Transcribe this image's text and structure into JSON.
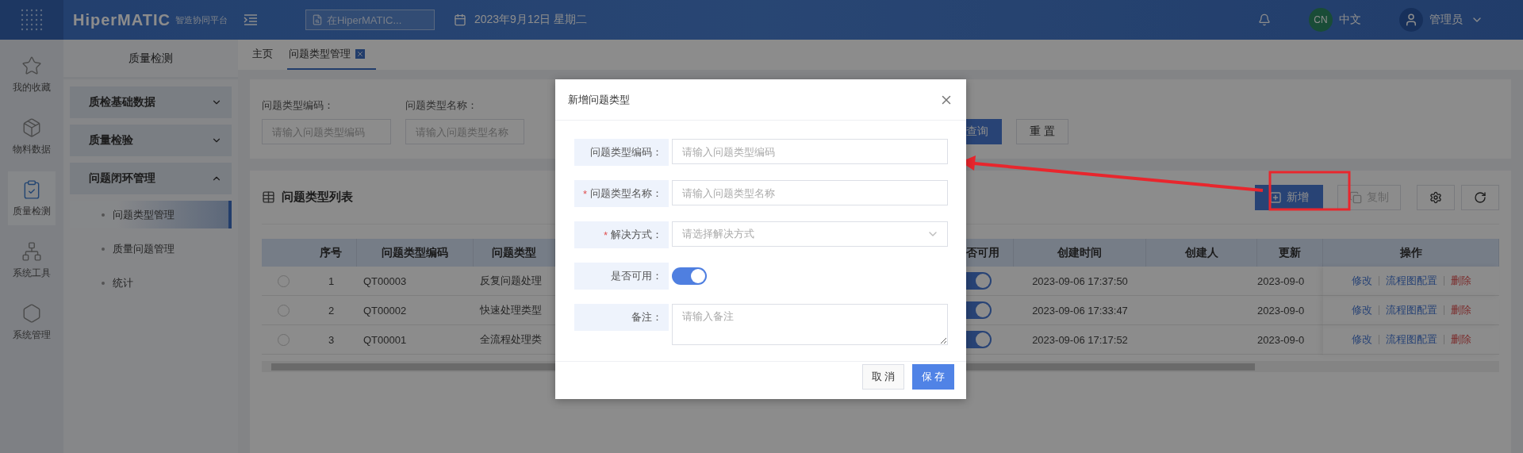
{
  "topbar": {
    "brand": "HiperMATIC",
    "brand_sub": "智造协同平台",
    "search": {
      "placeholder": "在HiperMATIC..."
    },
    "date": "2023年9月12日 星期二",
    "language_badge": "CN",
    "language": "中文",
    "user": "管理员"
  },
  "rail": [
    {
      "label": "我的收藏",
      "selected": false
    },
    {
      "label": "物料数据",
      "selected": false
    },
    {
      "label": "质量检测",
      "selected": true
    },
    {
      "label": "系统工具",
      "selected": false
    },
    {
      "label": "系统管理",
      "selected": false
    }
  ],
  "sidebar": {
    "title": "质量检测",
    "groups": [
      {
        "label": "质检基础数据",
        "expanded": false
      },
      {
        "label": "质量检验",
        "expanded": false
      },
      {
        "label": "问题闭环管理",
        "expanded": true,
        "children": [
          {
            "label": "问题类型管理",
            "selected": true
          },
          {
            "label": "质量问题管理",
            "selected": false
          },
          {
            "label": "统计",
            "selected": false
          }
        ]
      }
    ]
  },
  "tabs": [
    {
      "label": "主页",
      "selected": false,
      "closable": false
    },
    {
      "label": "问题类型管理",
      "selected": true,
      "closable": true
    }
  ],
  "filters": [
    {
      "label": "问题类型编码：",
      "placeholder": "请输入问题类型编码"
    },
    {
      "label": "问题类型名称：",
      "placeholder": "请输入问题类型名称"
    }
  ],
  "filter_buttons": [
    {
      "label": "查询",
      "kind": "primary"
    },
    {
      "label": "重 置",
      "kind": "default"
    }
  ],
  "list": {
    "title": "问题类型列表",
    "toolbar": [
      {
        "kind": "add",
        "label": "新增"
      },
      {
        "kind": "copy",
        "label": "复制",
        "disabled": true
      },
      {
        "kind": "settings"
      },
      {
        "kind": "refresh"
      }
    ],
    "columns": [
      "序号",
      "问题类型编码",
      "问题类型",
      "否可用",
      "创建时间",
      "创建人",
      "更新",
      "操作"
    ],
    "rows": [
      {
        "selected": false,
        "index": "1",
        "code": "QT00003",
        "name": "反复问题处理",
        "enabled": true,
        "created": "2023-09-06 17:37:50",
        "updated": "2023-09-0",
        "actions": [
          {
            "label": "修改",
            "kind": "edit"
          },
          {
            "label": "流程图配置",
            "kind": "edit"
          },
          {
            "label": "删除",
            "kind": "delete"
          }
        ]
      },
      {
        "selected": false,
        "index": "2",
        "code": "QT00002",
        "name": "快速处理类型",
        "enabled": true,
        "created": "2023-09-06 17:33:47",
        "updated": "2023-09-0",
        "actions": [
          {
            "label": "修改",
            "kind": "edit"
          },
          {
            "label": "流程图配置",
            "kind": "edit"
          },
          {
            "label": "删除",
            "kind": "delete"
          }
        ]
      },
      {
        "selected": false,
        "index": "3",
        "code": "QT00001",
        "name": "全流程处理类",
        "enabled": true,
        "created": "2023-09-06 17:17:52",
        "updated": "2023-09-0",
        "actions": [
          {
            "label": "修改",
            "kind": "edit"
          },
          {
            "label": "流程图配置",
            "kind": "edit"
          },
          {
            "label": "删除",
            "kind": "delete"
          }
        ]
      }
    ]
  },
  "dialog": {
    "title": "新增问题类型",
    "fields": [
      {
        "kind": "text",
        "label": "问题类型编码：",
        "placeholder": "请输入问题类型编码"
      },
      {
        "kind": "text",
        "mark": "*",
        "label": "问题类型名称：",
        "placeholder": "请输入问题类型名称"
      },
      {
        "kind": "select",
        "mark": "*",
        "label": "解决方式：",
        "placeholder": "请选择解决方式"
      },
      {
        "kind": "switch",
        "label": "是否可用：",
        "on": true
      },
      {
        "kind": "textarea",
        "label": "备注：",
        "placeholder": "请输入备注"
      }
    ],
    "buttons": [
      {
        "label": "取 消",
        "kind": "default"
      },
      {
        "label": "保 存",
        "kind": "primary"
      }
    ]
  }
}
